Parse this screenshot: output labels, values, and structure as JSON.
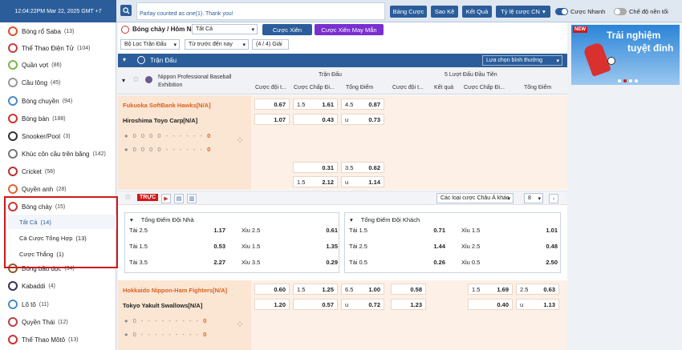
{
  "header": {
    "time": "12:04:22PM Mar 22, 2025 GMT +7",
    "marquee": "Parlay counted as one(1). Thank you!",
    "buttons": [
      "Bảng Cược",
      "Sao Kê",
      "Kết Quả",
      "Tỷ lệ cược CN"
    ],
    "toggle1": "Cược Nhanh",
    "toggle2": "Chế độ nền tối",
    "accent": "#2b5d9a"
  },
  "sidebar": {
    "items": [
      {
        "label": "Bóng rổ Saba",
        "count": "(13)",
        "color": "#d9532c"
      },
      {
        "label": "Thể Thao Điện Tử",
        "count": "(104)",
        "color": "#c24242"
      },
      {
        "label": "Quần vợt",
        "count": "(86)",
        "color": "#7bb64a"
      },
      {
        "label": "Cầu lông",
        "count": "(45)",
        "color": "#999"
      },
      {
        "label": "Bóng chuyền",
        "count": "(94)",
        "color": "#4a8ac9"
      },
      {
        "label": "Bóng bàn",
        "count": "(188)",
        "color": "#c33"
      },
      {
        "label": "Snooker/Pool",
        "count": "(3)",
        "color": "#333"
      },
      {
        "label": "Khúc côn cầu trên băng",
        "count": "(142)",
        "color": "#777"
      },
      {
        "label": "Cricket",
        "count": "(58)",
        "color": "#b33"
      },
      {
        "label": "Quyền anh",
        "count": "(28)",
        "color": "#d63"
      },
      {
        "label": "Bóng chày",
        "count": "(15)",
        "color": "#c33"
      },
      {
        "label": "Bóng bầu dục",
        "count": "(34)",
        "color": "#8a5a2b"
      },
      {
        "label": "Kabaddi",
        "count": "(4)",
        "color": "#335"
      },
      {
        "label": "Lô tô",
        "count": "(11)",
        "color": "#4a8ac9"
      },
      {
        "label": "Quyền Thái",
        "count": "(12)",
        "color": "#b44"
      },
      {
        "label": "Thể Thao Môtô",
        "count": "(13)",
        "color": "#c33"
      }
    ],
    "subitems": [
      {
        "label": "Tất Cả",
        "count": "(14)"
      },
      {
        "label": "Cá Cược Tổng Hợp",
        "count": "(13)"
      },
      {
        "label": "Cược Thắng",
        "count": "(1)"
      }
    ]
  },
  "main": {
    "breadcrumb": "Bóng chày / Hôm Nay",
    "filter_all": "Tất Cả",
    "parlay_btn": "Cược Xiên",
    "parlay_lucky": "Cược Xiên May Mắn",
    "league_filter": "Bộ Lọc Trận Đấu",
    "sort": "Từ trước đến nay",
    "league_count": "(4 / 4) Giải",
    "section": "Trận Đấu",
    "custom_view": "Lựa chọn bình thường",
    "league": "Nippon Professional Baseball Exhibition",
    "col_full": "Trận Đấu",
    "col_first5": "5 Lượt Đấu Đầu Tiên",
    "sub_cols": [
      "Cược đội t...",
      "Cược Chấp Đi...",
      "Tổng Điểm",
      "Cược đội t...",
      "Kết quả",
      "Cược Chấp Đi...",
      "Tổng Điểm"
    ],
    "match1": {
      "home": "Fukuoka SoftBank Hawks[N/A]",
      "away": "Hiroshima Toyo Carp[N/A]",
      "ml": [
        "0.67",
        "1.07"
      ],
      "hcp": [
        [
          "1.5",
          "1.61"
        ],
        [
          "",
          "0.43"
        ]
      ],
      "ou": [
        [
          "4.5",
          "0.87"
        ],
        [
          "u",
          "0.73"
        ]
      ],
      "alt": [
        [
          "",
          "0.31",
          "3.5",
          "0.62"
        ],
        [
          "1.5",
          "2.12",
          "u",
          "1.14"
        ]
      ],
      "score_home": [
        "0",
        "0",
        "0",
        "0",
        "-",
        "-",
        "-",
        "-",
        "-",
        "-",
        "0"
      ],
      "score_away": [
        "0",
        "0",
        "0",
        "0",
        "-",
        "-",
        "-",
        "-",
        "-",
        "-",
        "0"
      ]
    },
    "live_tag": "TRỰC",
    "market_select": "Các loại cược Châu Á khác",
    "page": "8",
    "home_total": "Tổng Điểm Đội Nhà",
    "away_total": "Tổng Điểm Đội Khách",
    "home_lines": [
      [
        "Tài 2.5",
        "1.17",
        "Xỉu 2.5",
        "0.61"
      ],
      [
        "Tài 1.5",
        "0.53",
        "Xỉu 1.5",
        "1.35"
      ],
      [
        "Tài 3.5",
        "2.27",
        "Xỉu 3.5",
        "0.29"
      ]
    ],
    "away_lines": [
      [
        "Tài 1.5",
        "0.71",
        "Xỉu 1.5",
        "1.01"
      ],
      [
        "Tài 2.5",
        "1.44",
        "Xỉu 2.5",
        "0.48"
      ],
      [
        "Tài 0.5",
        "0.26",
        "Xỉu 0.5",
        "2.50"
      ]
    ],
    "match2": {
      "home": "Hokkaido Nippon-Ham Fighters[N/A]",
      "away": "Tokyo Yakult Swallows[N/A]",
      "ml": [
        "0.60",
        "1.20"
      ],
      "hcp": [
        [
          "1.5",
          "1.25"
        ],
        [
          "",
          "0.57"
        ]
      ],
      "ou": [
        [
          "6.5",
          "1.00"
        ],
        [
          "u",
          "0.72"
        ]
      ],
      "ml5": [
        "0.58",
        "1.23"
      ],
      "hcp5": [
        [
          "1.5",
          "1.69"
        ],
        [
          "",
          "0.40"
        ]
      ],
      "ou5": [
        [
          "2.5",
          "0.63"
        ],
        [
          "u",
          "1.13"
        ]
      ]
    }
  },
  "banner": {
    "line1": "Trải nghiệm",
    "line2": "tuyệt đỉnh",
    "badge": "NEW"
  }
}
